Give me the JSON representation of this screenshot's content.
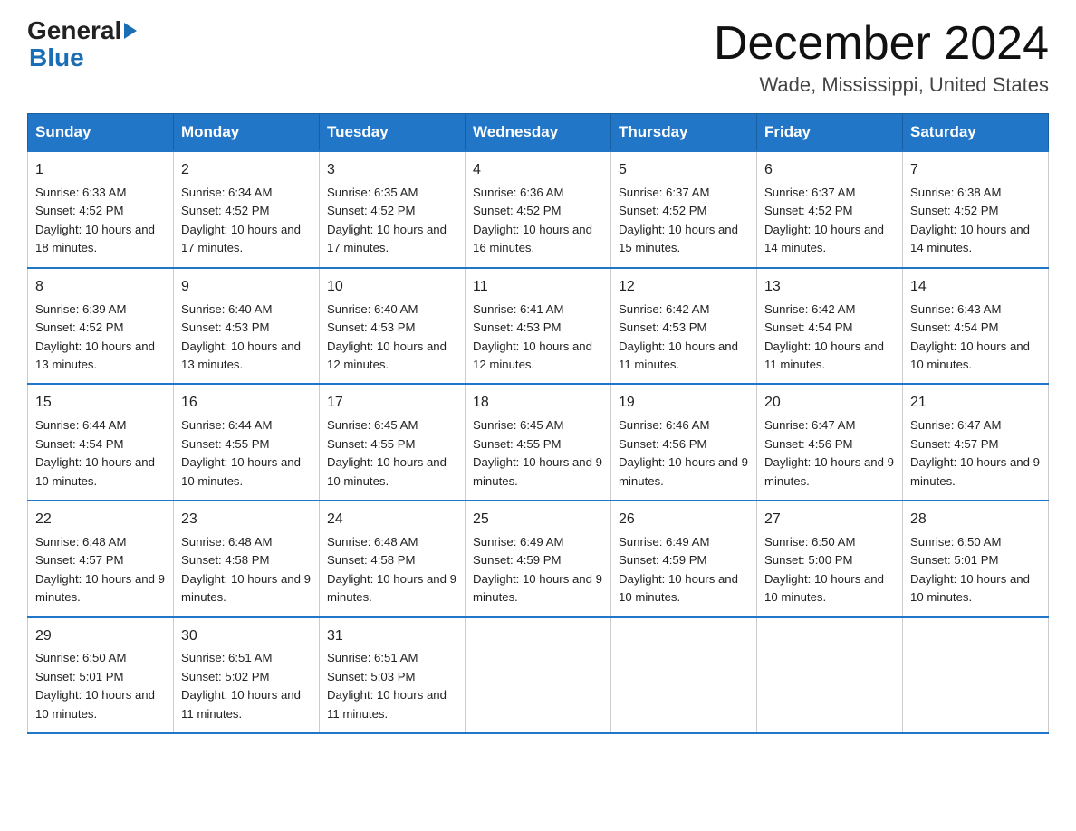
{
  "logo": {
    "general": "General",
    "blue": "Blue"
  },
  "title": "December 2024",
  "location": "Wade, Mississippi, United States",
  "days_of_week": [
    "Sunday",
    "Monday",
    "Tuesday",
    "Wednesday",
    "Thursday",
    "Friday",
    "Saturday"
  ],
  "weeks": [
    [
      {
        "day": "1",
        "sunrise": "6:33 AM",
        "sunset": "4:52 PM",
        "daylight": "10 hours and 18 minutes."
      },
      {
        "day": "2",
        "sunrise": "6:34 AM",
        "sunset": "4:52 PM",
        "daylight": "10 hours and 17 minutes."
      },
      {
        "day": "3",
        "sunrise": "6:35 AM",
        "sunset": "4:52 PM",
        "daylight": "10 hours and 17 minutes."
      },
      {
        "day": "4",
        "sunrise": "6:36 AM",
        "sunset": "4:52 PM",
        "daylight": "10 hours and 16 minutes."
      },
      {
        "day": "5",
        "sunrise": "6:37 AM",
        "sunset": "4:52 PM",
        "daylight": "10 hours and 15 minutes."
      },
      {
        "day": "6",
        "sunrise": "6:37 AM",
        "sunset": "4:52 PM",
        "daylight": "10 hours and 14 minutes."
      },
      {
        "day": "7",
        "sunrise": "6:38 AM",
        "sunset": "4:52 PM",
        "daylight": "10 hours and 14 minutes."
      }
    ],
    [
      {
        "day": "8",
        "sunrise": "6:39 AM",
        "sunset": "4:52 PM",
        "daylight": "10 hours and 13 minutes."
      },
      {
        "day": "9",
        "sunrise": "6:40 AM",
        "sunset": "4:53 PM",
        "daylight": "10 hours and 13 minutes."
      },
      {
        "day": "10",
        "sunrise": "6:40 AM",
        "sunset": "4:53 PM",
        "daylight": "10 hours and 12 minutes."
      },
      {
        "day": "11",
        "sunrise": "6:41 AM",
        "sunset": "4:53 PM",
        "daylight": "10 hours and 12 minutes."
      },
      {
        "day": "12",
        "sunrise": "6:42 AM",
        "sunset": "4:53 PM",
        "daylight": "10 hours and 11 minutes."
      },
      {
        "day": "13",
        "sunrise": "6:42 AM",
        "sunset": "4:54 PM",
        "daylight": "10 hours and 11 minutes."
      },
      {
        "day": "14",
        "sunrise": "6:43 AM",
        "sunset": "4:54 PM",
        "daylight": "10 hours and 10 minutes."
      }
    ],
    [
      {
        "day": "15",
        "sunrise": "6:44 AM",
        "sunset": "4:54 PM",
        "daylight": "10 hours and 10 minutes."
      },
      {
        "day": "16",
        "sunrise": "6:44 AM",
        "sunset": "4:55 PM",
        "daylight": "10 hours and 10 minutes."
      },
      {
        "day": "17",
        "sunrise": "6:45 AM",
        "sunset": "4:55 PM",
        "daylight": "10 hours and 10 minutes."
      },
      {
        "day": "18",
        "sunrise": "6:45 AM",
        "sunset": "4:55 PM",
        "daylight": "10 hours and 9 minutes."
      },
      {
        "day": "19",
        "sunrise": "6:46 AM",
        "sunset": "4:56 PM",
        "daylight": "10 hours and 9 minutes."
      },
      {
        "day": "20",
        "sunrise": "6:47 AM",
        "sunset": "4:56 PM",
        "daylight": "10 hours and 9 minutes."
      },
      {
        "day": "21",
        "sunrise": "6:47 AM",
        "sunset": "4:57 PM",
        "daylight": "10 hours and 9 minutes."
      }
    ],
    [
      {
        "day": "22",
        "sunrise": "6:48 AM",
        "sunset": "4:57 PM",
        "daylight": "10 hours and 9 minutes."
      },
      {
        "day": "23",
        "sunrise": "6:48 AM",
        "sunset": "4:58 PM",
        "daylight": "10 hours and 9 minutes."
      },
      {
        "day": "24",
        "sunrise": "6:48 AM",
        "sunset": "4:58 PM",
        "daylight": "10 hours and 9 minutes."
      },
      {
        "day": "25",
        "sunrise": "6:49 AM",
        "sunset": "4:59 PM",
        "daylight": "10 hours and 9 minutes."
      },
      {
        "day": "26",
        "sunrise": "6:49 AM",
        "sunset": "4:59 PM",
        "daylight": "10 hours and 10 minutes."
      },
      {
        "day": "27",
        "sunrise": "6:50 AM",
        "sunset": "5:00 PM",
        "daylight": "10 hours and 10 minutes."
      },
      {
        "day": "28",
        "sunrise": "6:50 AM",
        "sunset": "5:01 PM",
        "daylight": "10 hours and 10 minutes."
      }
    ],
    [
      {
        "day": "29",
        "sunrise": "6:50 AM",
        "sunset": "5:01 PM",
        "daylight": "10 hours and 10 minutes."
      },
      {
        "day": "30",
        "sunrise": "6:51 AM",
        "sunset": "5:02 PM",
        "daylight": "10 hours and 11 minutes."
      },
      {
        "day": "31",
        "sunrise": "6:51 AM",
        "sunset": "5:03 PM",
        "daylight": "10 hours and 11 minutes."
      },
      {
        "day": "",
        "sunrise": "",
        "sunset": "",
        "daylight": ""
      },
      {
        "day": "",
        "sunrise": "",
        "sunset": "",
        "daylight": ""
      },
      {
        "day": "",
        "sunrise": "",
        "sunset": "",
        "daylight": ""
      },
      {
        "day": "",
        "sunrise": "",
        "sunset": "",
        "daylight": ""
      }
    ]
  ]
}
